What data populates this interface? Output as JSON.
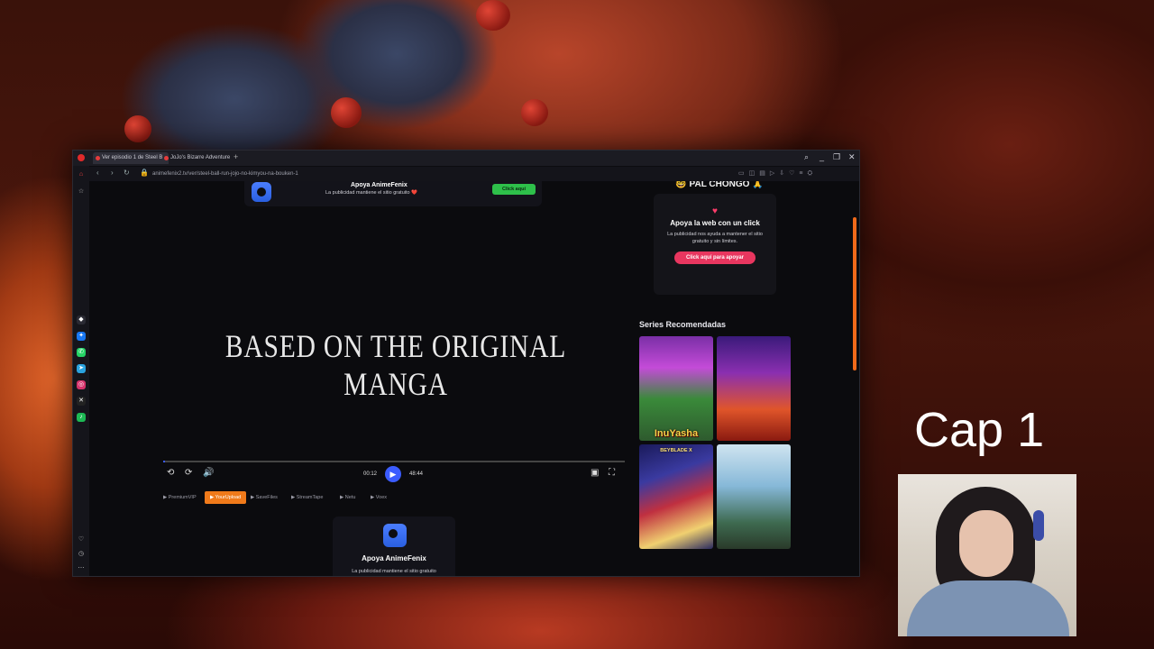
{
  "browser": {
    "tabs": [
      {
        "label": "Ver episodio 1 de Steel B"
      },
      {
        "label": "JoJo's Bizarre Adventure"
      }
    ],
    "url": "animefenix2.tv/ver/steel-ball-run-jojo-no-kimyou-na-bouken-1"
  },
  "video": {
    "overlay_text": "BASED ON THE ORIGINAL MANGA",
    "current_time": "00:12",
    "duration": "48:44",
    "progress_fraction": 0.004
  },
  "ad_top": {
    "title": "Apoya AnimeFenix",
    "subtitle": "La publicidad mantiene el sitio gratuito ❤️",
    "button": "Click aquí"
  },
  "servers": [
    {
      "label": "PremiumVIP",
      "active": false
    },
    {
      "label": "YourUpload",
      "active": true
    },
    {
      "label": "SaveFiles",
      "active": false
    },
    {
      "label": "StreamTape",
      "active": false
    },
    {
      "label": "Netu",
      "active": false
    },
    {
      "label": "Voex",
      "active": false
    }
  ],
  "ad_bottom": {
    "title": "Apoya AnimeFenix",
    "subtitle": "La publicidad mantiene el sitio gratuito"
  },
  "sidebar_right": {
    "pal_chongo": "🤓 PAL CHONGO 🙏",
    "support_title": "Apoya la web con un click",
    "support_text": "La publicidad nos ayuda a mantener el sitio gratuito y sin límites.",
    "support_button": "Click aquí para apoyar",
    "recommended_title": "Series Recomendadas",
    "posters": [
      {
        "title": "InuYasha"
      },
      {
        "title": ""
      },
      {
        "title": "BEYBLADE X"
      },
      {
        "title": ""
      }
    ]
  },
  "stream_overlay": {
    "caption": "Cap 1"
  }
}
